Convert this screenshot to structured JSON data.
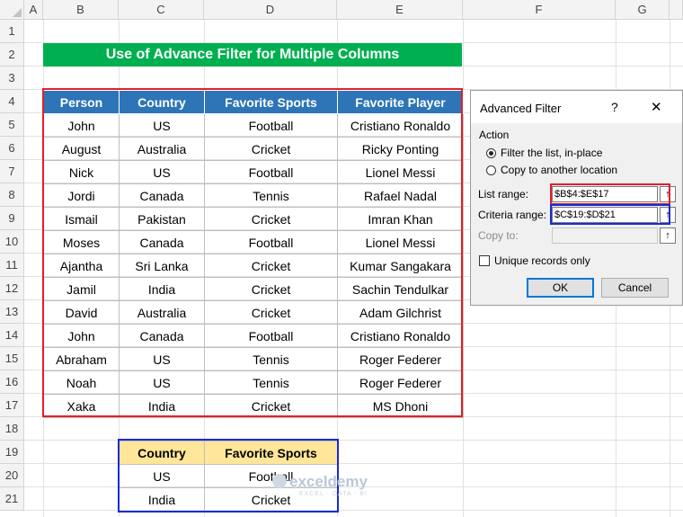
{
  "columns": [
    "A",
    "B",
    "C",
    "D",
    "E",
    "F",
    "G"
  ],
  "rows": [
    "1",
    "2",
    "3",
    "4",
    "5",
    "6",
    "7",
    "8",
    "9",
    "10",
    "11",
    "12",
    "13",
    "14",
    "15",
    "16",
    "17",
    "18",
    "19",
    "20",
    "21"
  ],
  "title": "Use of Advance Filter for Multiple Columns",
  "main_table": {
    "headers": [
      "Person",
      "Country",
      "Favorite Sports",
      "Favorite Player"
    ],
    "rows": [
      [
        "John",
        "US",
        "Football",
        "Cristiano Ronaldo"
      ],
      [
        "August",
        "Australia",
        "Cricket",
        "Ricky Ponting"
      ],
      [
        "Nick",
        "US",
        "Football",
        "Lionel Messi"
      ],
      [
        "Jordi",
        "Canada",
        "Tennis",
        "Rafael Nadal"
      ],
      [
        "Ismail",
        "Pakistan",
        "Cricket",
        "Imran Khan"
      ],
      [
        "Moses",
        "Canada",
        "Football",
        "Lionel Messi"
      ],
      [
        "Ajantha",
        "Sri Lanka",
        "Cricket",
        "Kumar Sangakara"
      ],
      [
        "Jamil",
        "India",
        "Cricket",
        "Sachin Tendulkar"
      ],
      [
        "David",
        "Australia",
        "Cricket",
        "Adam Gilchrist"
      ],
      [
        "John",
        "Canada",
        "Football",
        "Cristiano Ronaldo"
      ],
      [
        "Abraham",
        "US",
        "Tennis",
        "Roger Federer"
      ],
      [
        "Noah",
        "US",
        "Tennis",
        "Roger Federer"
      ],
      [
        "Xaka",
        "India",
        "Cricket",
        "MS Dhoni"
      ]
    ]
  },
  "criteria_table": {
    "headers": [
      "Country",
      "Favorite Sports"
    ],
    "rows": [
      [
        "US",
        "Football"
      ],
      [
        "India",
        "Cricket"
      ]
    ]
  },
  "dialog": {
    "title": "Advanced Filter",
    "help": "?",
    "close": "✕",
    "action_label": "Action",
    "option_filter": "Filter the list, in-place",
    "option_copy": "Copy to another location",
    "list_range_label": "List range:",
    "list_range_value": "$B$4:$E$17",
    "criteria_range_label": "Criteria range:",
    "criteria_range_value": "$C$19:$D$21",
    "copy_to_label": "Copy to:",
    "copy_to_value": "",
    "unique_label": "Unique records only",
    "ok_label": "OK",
    "cancel_label": "Cancel",
    "collapse_icon": "↑"
  },
  "watermark": {
    "name": "exceldemy",
    "sub": "EXCEL · DATA · BI"
  },
  "colors": {
    "title_bg": "#00b050",
    "header_bg": "#2d75b6",
    "criteria_bg": "#ffe699",
    "red_outline": "#e0202a",
    "blue_outline": "#1a2ad8"
  }
}
